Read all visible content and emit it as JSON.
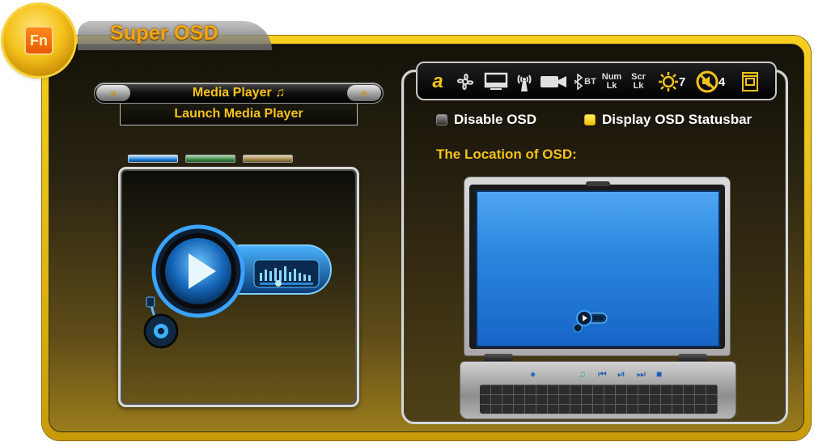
{
  "app": {
    "title": "Super OSD",
    "fn_badge": "Fn"
  },
  "left": {
    "selector": {
      "label": "Media Player ♫",
      "prev_icon": "double-chevron-left",
      "next_icon": "double-chevron-right"
    },
    "launch_button": "Launch Media Player",
    "color_tabs": [
      {
        "name": "blue",
        "color": "#1e7fd6"
      },
      {
        "name": "green",
        "color": "#3f8a49"
      },
      {
        "name": "tan",
        "color": "#a48a4a"
      }
    ],
    "preview_icon": "media-player-widget-icon"
  },
  "toolbar": {
    "icons": [
      {
        "name": "logo-a-icon",
        "text": "a"
      },
      {
        "name": "fan-icon"
      },
      {
        "name": "display-switch-icon"
      },
      {
        "name": "wireless-icon"
      },
      {
        "name": "webcam-icon"
      },
      {
        "name": "bluetooth-icon",
        "text": "BT"
      },
      {
        "name": "num-lock",
        "line1": "Num",
        "line2": "Lk"
      },
      {
        "name": "scroll-lock",
        "line1": "Scr",
        "line2": "Lk"
      },
      {
        "name": "brightness-icon",
        "value": "7"
      },
      {
        "name": "mute-icon",
        "value": "4"
      },
      {
        "name": "touchpad-icon"
      }
    ]
  },
  "options": {
    "disable_osd": {
      "label": "Disable OSD",
      "checked": false
    },
    "display_statusbar": {
      "label": "Display OSD Statusbar",
      "checked": true
    }
  },
  "location": {
    "label": "The Location of OSD:"
  },
  "colors": {
    "accent": "#f3c21b",
    "frame": "#e0b311",
    "screen": "#2b86de"
  }
}
